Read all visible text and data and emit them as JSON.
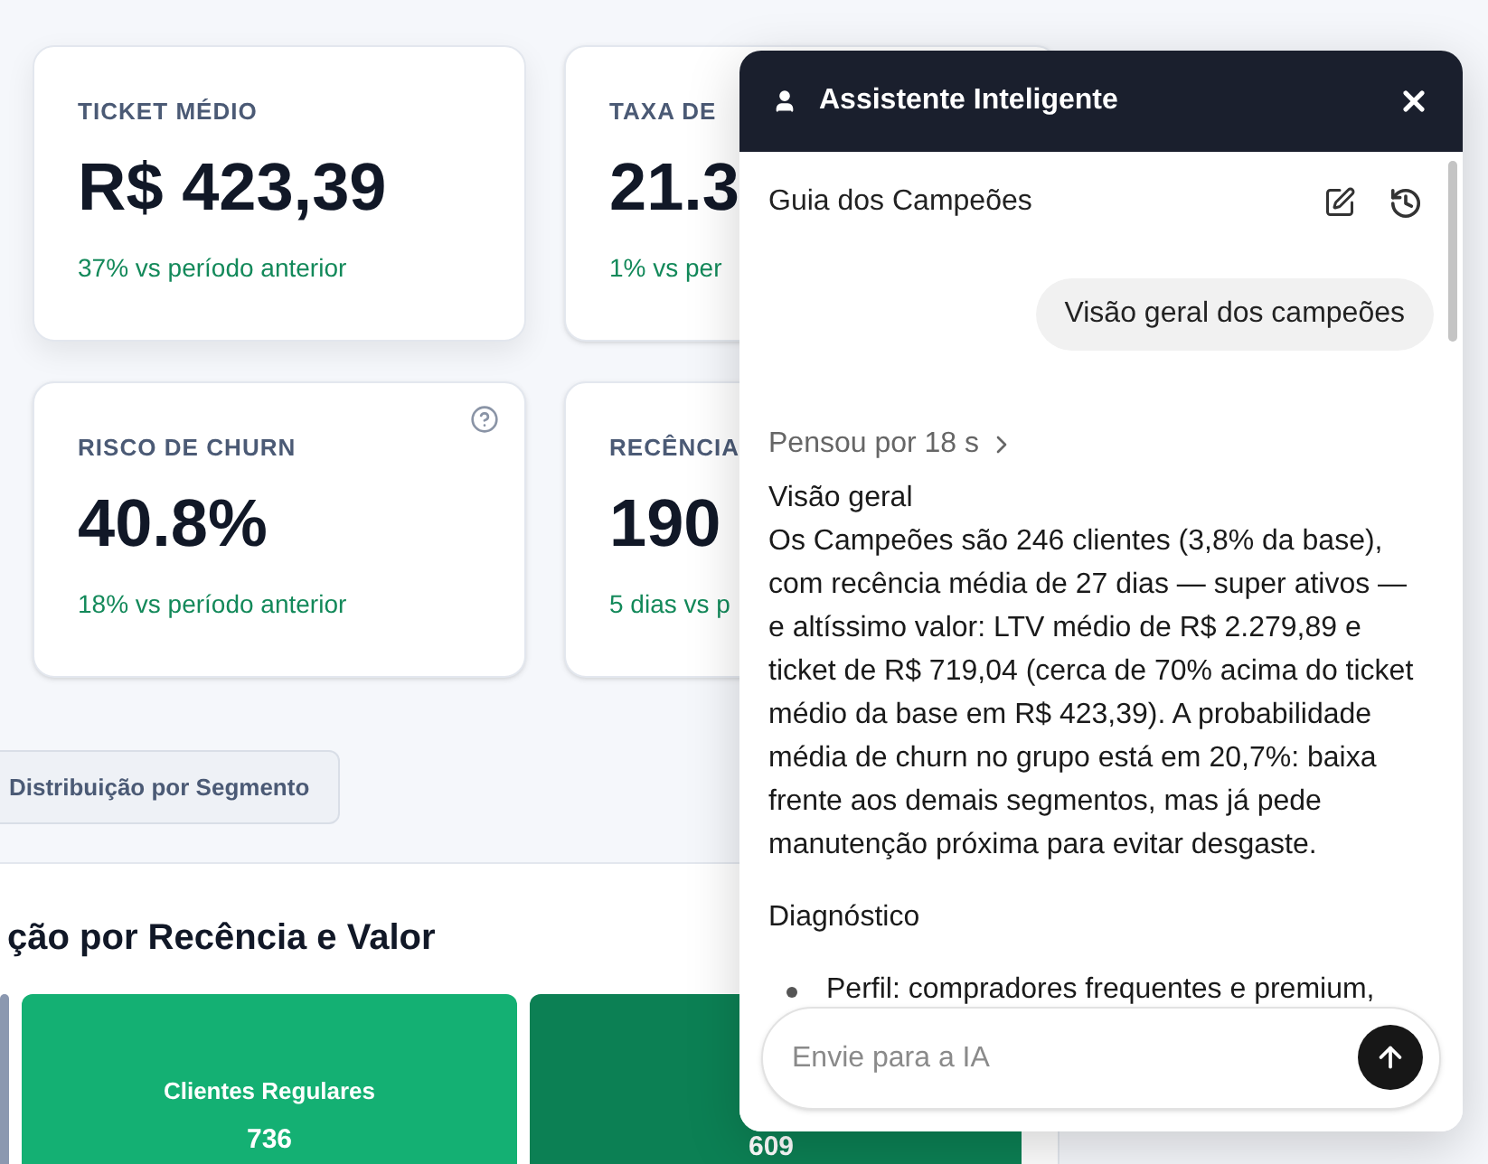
{
  "metrics": [
    {
      "label": "TICKET MÉDIO",
      "value": "R$ 423,39",
      "delta": "37% vs período anterior",
      "help": false
    },
    {
      "label": "TAXA DE",
      "value": "21.3",
      "delta": "1% vs per",
      "help": false
    },
    {
      "label": "RISCO DE CHURN",
      "value": "40.8%",
      "delta": "18% vs período anterior",
      "help": true
    },
    {
      "label": "RECÊNCIA",
      "value": "190",
      "delta": "5 dias vs p",
      "help": false
    }
  ],
  "segment_button": "Distribuição por Segmento",
  "section": {
    "title": "ção por Recência e Valor",
    "tiles": [
      {
        "color": "#8b98b0"
      },
      {
        "name": "Clientes Regulares",
        "value": "736",
        "color": "#14b073"
      },
      {
        "value": "609",
        "color": "#0c8054"
      }
    ]
  },
  "assistant": {
    "title": "Assistente Inteligente",
    "conversation": "Guia dos Campeões",
    "user_message": "Visão geral dos campeões",
    "thought": "Pensou por 18 s",
    "blocks": [
      {
        "kind": "heading",
        "text": "Visão geral"
      },
      {
        "kind": "paragraph",
        "text": "Os Campeões são 246 clientes (3,8% da base), com recência média de 27 dias — super ativos — e altíssimo valor: LTV médio de R$ 2.279,89 e ticket de R$ 719,04 (cerca de 70% acima do ticket médio da base em R$ 423,39). A probabilidade média de churn no grupo está em 20,7%: baixa frente aos demais segmentos, mas já pede manutenção próxima para evitar desgaste."
      },
      {
        "kind": "heading",
        "text": "Diagnóstico"
      },
      {
        "kind": "bullet",
        "text": "Perfil: compradores frequentes e premium,"
      }
    ],
    "input": {
      "placeholder": "Envie para a IA"
    }
  }
}
